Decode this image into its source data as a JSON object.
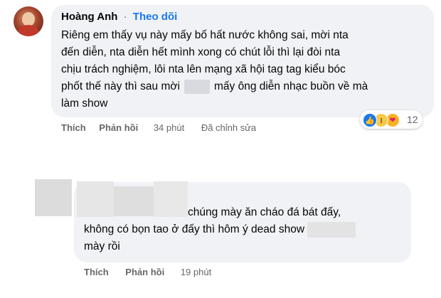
{
  "comment1": {
    "author": "Hoàng Anh",
    "separator": "·",
    "follow_label": "Theo dõi",
    "lines": [
      "Riêng em thấy vụ này mấy bố hất nước không sai, mời nta",
      "đến diễn, nta diễn hết mình xong có chút lỗi thì lại đòi nta",
      "chịu trách nghiệm, lôi nta lên mạng xã hội tag tag kiểu bóc",
      "phốt thế này thì sau mời",
      "mấy ông diễn nhạc buồn về mà",
      "làm show"
    ],
    "reactions": {
      "icons": [
        "like-icon",
        "haha-icon",
        "care-icon"
      ],
      "count": "12"
    },
    "actions": {
      "like_label": "Thích",
      "reply_label": "Phản hồi",
      "time": "34 phút",
      "edited_label": "Đã chỉnh sửa"
    }
  },
  "comment2": {
    "lines": [
      "chúng mày ăn cháo đá bát đấy,",
      "không có bọn tao ở đấy thì hôm ý dead show",
      "mày rồi"
    ],
    "actions": {
      "like_label": "Thích",
      "reply_label": "Phản hồi",
      "time": "19 phút"
    }
  },
  "colors": {
    "bubble": "#f0f2f5",
    "link": "#1877f2",
    "secondary_text": "#65676b",
    "like": "#1877f2",
    "haha": "#f7c94b",
    "redaction": "#d8dadf"
  }
}
